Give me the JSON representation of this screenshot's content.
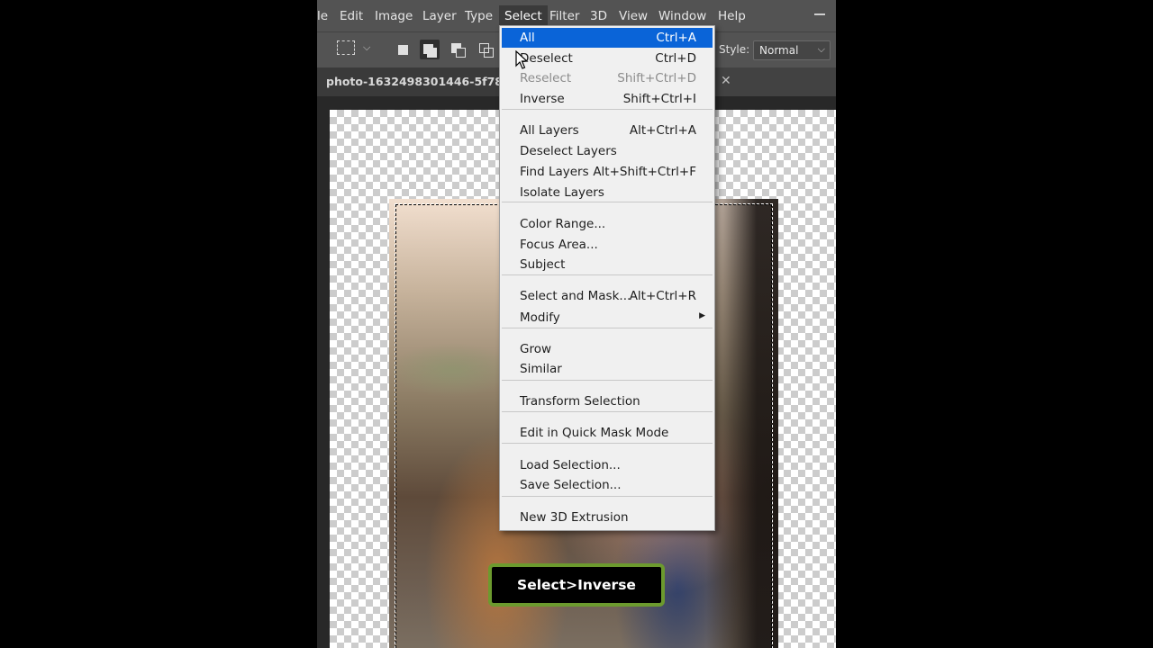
{
  "menubar": {
    "items": [
      "le",
      "Edit",
      "Image",
      "Layer",
      "Type",
      "Select",
      "Filter",
      "3D",
      "View",
      "Window",
      "Help"
    ],
    "active": "Select"
  },
  "options": {
    "style_label": "Style:",
    "style_value": "Normal"
  },
  "document": {
    "tab_title": "photo-1632498301446-5f78baa"
  },
  "select_menu": {
    "items": [
      {
        "label": "All",
        "shortcut": "Ctrl+A",
        "highlighted": true
      },
      {
        "label": "Deselect",
        "shortcut": "Ctrl+D"
      },
      {
        "label": "Reselect",
        "shortcut": "Shift+Ctrl+D",
        "disabled": true
      },
      {
        "label": "Inverse",
        "shortcut": "Shift+Ctrl+I"
      },
      {
        "label": "All Layers",
        "shortcut": "Alt+Ctrl+A"
      },
      {
        "label": "Deselect Layers",
        "shortcut": ""
      },
      {
        "label": "Find Layers",
        "shortcut": "Alt+Shift+Ctrl+F"
      },
      {
        "label": "Isolate Layers",
        "shortcut": ""
      },
      {
        "label": "Color Range...",
        "shortcut": ""
      },
      {
        "label": "Focus Area...",
        "shortcut": ""
      },
      {
        "label": "Subject",
        "shortcut": ""
      },
      {
        "label": "Select and Mask...",
        "shortcut": "Alt+Ctrl+R"
      },
      {
        "label": "Modify",
        "shortcut": "",
        "submenu": true
      },
      {
        "label": "Grow",
        "shortcut": ""
      },
      {
        "label": "Similar",
        "shortcut": ""
      },
      {
        "label": "Transform Selection",
        "shortcut": ""
      },
      {
        "label": "Edit in Quick Mask Mode",
        "shortcut": ""
      },
      {
        "label": "Load Selection...",
        "shortcut": ""
      },
      {
        "label": "Save Selection...",
        "shortcut": ""
      },
      {
        "label": "New 3D Extrusion",
        "shortcut": ""
      }
    ]
  },
  "caption": "Select>Inverse",
  "colors": {
    "highlight": "#0a64d8",
    "caption_border": "#6c9a2e",
    "ui_background": "#535353"
  }
}
